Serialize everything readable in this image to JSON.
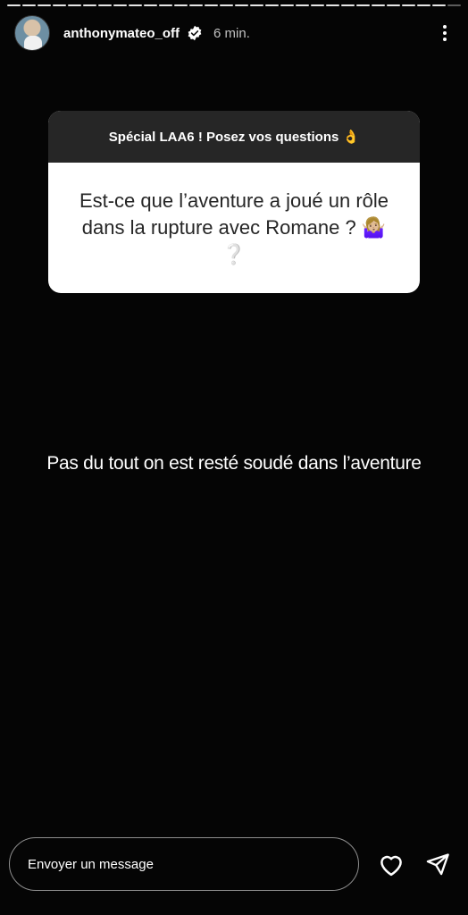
{
  "story": {
    "segments_total": 30,
    "segments_viewed": 29
  },
  "header": {
    "username": "anthonymateo_off",
    "time": "6 min."
  },
  "question": {
    "title": "Spécial LAA6 ! Posez vos questions 👌",
    "text": "Est-ce que l’aventure a joué un rôle dans la rupture avec Romane ? 🤷🏼‍♀️ ❔"
  },
  "answer": {
    "text": "Pas du tout on est resté soudé dans l’aventure"
  },
  "footer": {
    "message_placeholder": "Envoyer un message"
  },
  "icons": {
    "verified": "verified-badge-icon",
    "more": "more-options-icon",
    "like": "heart-icon",
    "share": "send-icon"
  }
}
